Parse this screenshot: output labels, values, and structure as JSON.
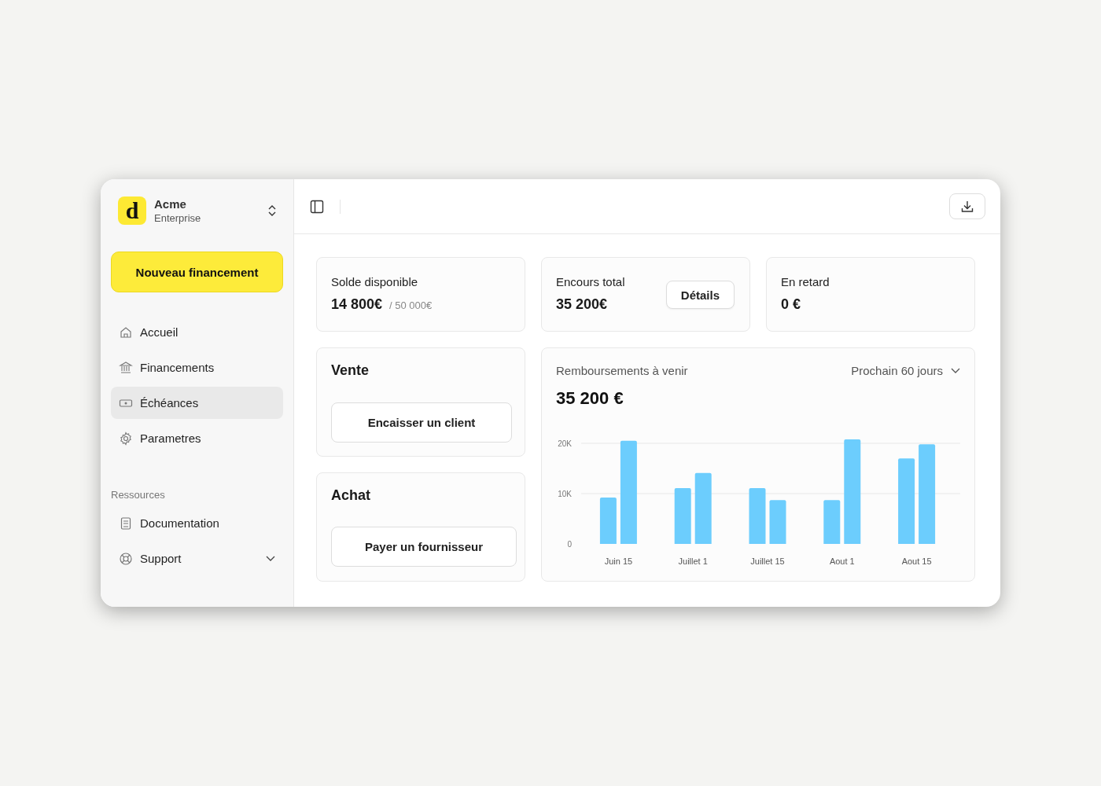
{
  "workspace": {
    "logo": "d",
    "name": "Acme",
    "plan": "Enterprise"
  },
  "new_button": "Nouveau financement",
  "nav": [
    {
      "label": "Accueil",
      "selected": false
    },
    {
      "label": "Financements",
      "selected": false
    },
    {
      "label": "Échéances",
      "selected": true
    },
    {
      "label": "Parametres",
      "selected": false
    }
  ],
  "resources": {
    "title": "Ressources",
    "items": [
      {
        "label": "Documentation",
        "kind": "link"
      },
      {
        "label": "Support",
        "kind": "dropdown"
      }
    ]
  },
  "stats": [
    {
      "label": "Solde disponible",
      "value": "14 800€",
      "secondary": "/ 50 000€"
    },
    {
      "label": "Encours total",
      "value": "35 200€",
      "button": "Détails"
    },
    {
      "label": "En retard",
      "value": "0 €"
    }
  ],
  "actions": [
    {
      "title": "Vente",
      "button": "Encaisser un client"
    },
    {
      "title": "Achat",
      "button": "Payer un fournisseur"
    }
  ],
  "repayments": {
    "title": "Remboursements à venir",
    "period": "Prochain 60 jours",
    "total": "35 200 €",
    "chart_data": {
      "type": "bar",
      "categories": [
        "Juin 15",
        "Juillet 1",
        "Juillet 15",
        "Aout 1",
        "Aout 15"
      ],
      "ylim": [
        0,
        21000
      ],
      "yticks": [
        {
          "value": 0,
          "label": "0"
        },
        {
          "value": 10000,
          "label": "10K"
        },
        {
          "value": 20000,
          "label": "20K"
        }
      ],
      "series": [
        {
          "color": "#6ccdfd",
          "values": [
            9200,
            11100,
            11100,
            8700,
            17000
          ]
        },
        {
          "color": "#6ccdfd",
          "values": [
            20500,
            14100,
            8700,
            20800,
            19800
          ]
        }
      ]
    }
  }
}
